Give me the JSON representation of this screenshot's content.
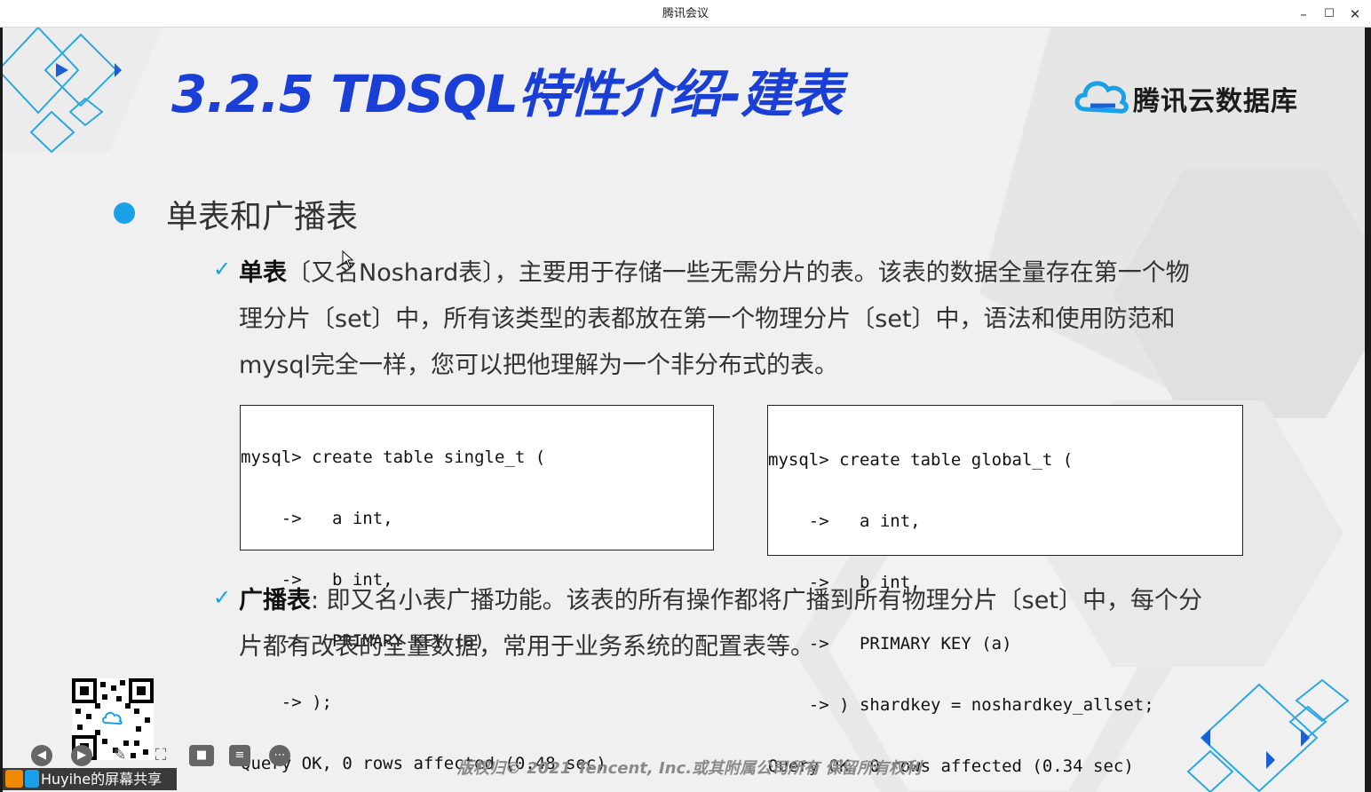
{
  "window": {
    "title": "腾讯会议",
    "controls": {
      "minimize": "–",
      "maximize": "☐",
      "close": "✕"
    }
  },
  "slide": {
    "title": "3.2.5 TDSQL特性介绍-建表",
    "brand": "腾讯云数据库",
    "heading": "单表和广播表",
    "single": {
      "term": "单表",
      "lines": [
        "〔又名Noshard表〕，主要用于存储一些无需分片的表。该表的数据全量存在第一个物",
        "理分片〔set〕中，所有该类型的表都放在第一个物理分片〔set〕中，语法和使用防范和",
        "mysql完全一样，您可以把他理解为一个非分布式的表。"
      ],
      "code": [
        "mysql> create table single_t (",
        "    ->   a int,",
        "    ->   b int,",
        "    ->   PRIMARY KEY (a)",
        "    -> );",
        "Query OK, 0 rows affected (0.48 sec)"
      ]
    },
    "global": {
      "code": [
        "mysql> create table global_t (",
        "    ->   a int,",
        "    ->   b int,",
        "    ->   PRIMARY KEY (a)",
        "    -> ) shardkey = noshardkey_allset;",
        "Query OK, 0 rows affected (0.34 sec)"
      ]
    },
    "broadcast": {
      "term": "广播表",
      "lines": [
        ":  即又名小表广播功能。该表的所有操作都将广播到所有物理分片〔set〕中，每个分",
        "片都有改表的全量数据，常用于业务系统的配置表等。"
      ]
    },
    "footer": "版权归© 2021 Tencent, Inc.或其附属公司所有 保留所有权利"
  },
  "meeting": {
    "share_label": "Huyihe的屏幕共享",
    "controls": [
      "back-icon",
      "forward-icon",
      "pen-icon",
      "screenshot-icon",
      "camera-icon",
      "chat-icon",
      "more-icon"
    ]
  },
  "colors": {
    "title_blue": "#1a3fd6",
    "accent_cyan": "#1aa0e6",
    "slide_bg": "#f0f0f0"
  }
}
